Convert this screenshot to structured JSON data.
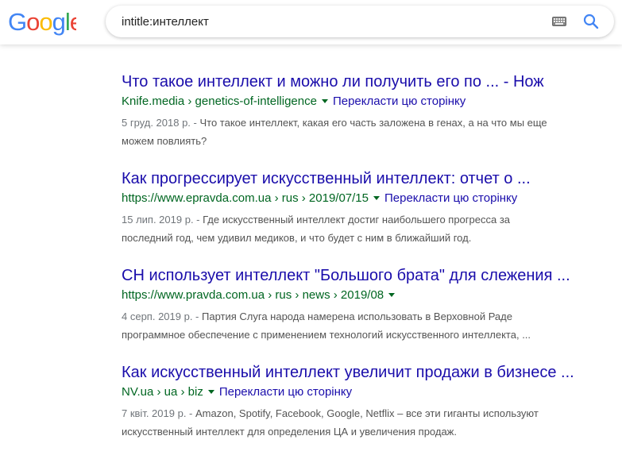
{
  "search": {
    "query": "intitle:интеллект"
  },
  "colors": {
    "link": "#1a0dab",
    "url_green": "#006621",
    "snippet": "#545454"
  },
  "results": [
    {
      "title": "Что такое интеллект и можно ли получить его по ... - Нож",
      "breadcrumb": "Knife.media › genetics-of-intelligence",
      "translate": "Перекласти цю сторінку",
      "date": "5 груд. 2018 р. - ",
      "snippet_1": "Что такое интеллект, какая его часть заложена в генах, а на что мы еще",
      "snippet_2": "можем повлиять?"
    },
    {
      "title": "Как прогрессирует искусственный интеллект: отчет о ...",
      "breadcrumb": "https://www.epravda.com.ua › rus › 2019/07/15",
      "translate": "Перекласти цю сторінку",
      "date": "15 лип. 2019 р. - ",
      "snippet_1": "Где искусственный интеллект достиг наибольшего прогресса за",
      "snippet_2": "последний год, чем удивил медиков, и что будет с ним в ближайший год."
    },
    {
      "title": "CН использует интеллект \"Большого брата\" для слежения ...",
      "breadcrumb": "https://www.pravda.com.ua › rus › news › 2019/08",
      "translate": "",
      "date": "4 серп. 2019 р. - ",
      "snippet_1": "Партия Слуга народа намерена использовать в Верховной Раде",
      "snippet_2": "программное обеспечение с применением технологий искусственного интеллекта, ..."
    },
    {
      "title": "Как искусственный интеллект увеличит продажи в бизнесе ...",
      "breadcrumb": "NV.ua › ua › biz",
      "translate": "Перекласти цю сторінку",
      "date": "7 квіт. 2019 р. - ",
      "snippet_1": "Amazon, Spotify, Facebook, Google, Netflix – все эти гиганты используют",
      "snippet_2": "искусственный интеллект для определения ЦА и увеличения продаж."
    }
  ]
}
